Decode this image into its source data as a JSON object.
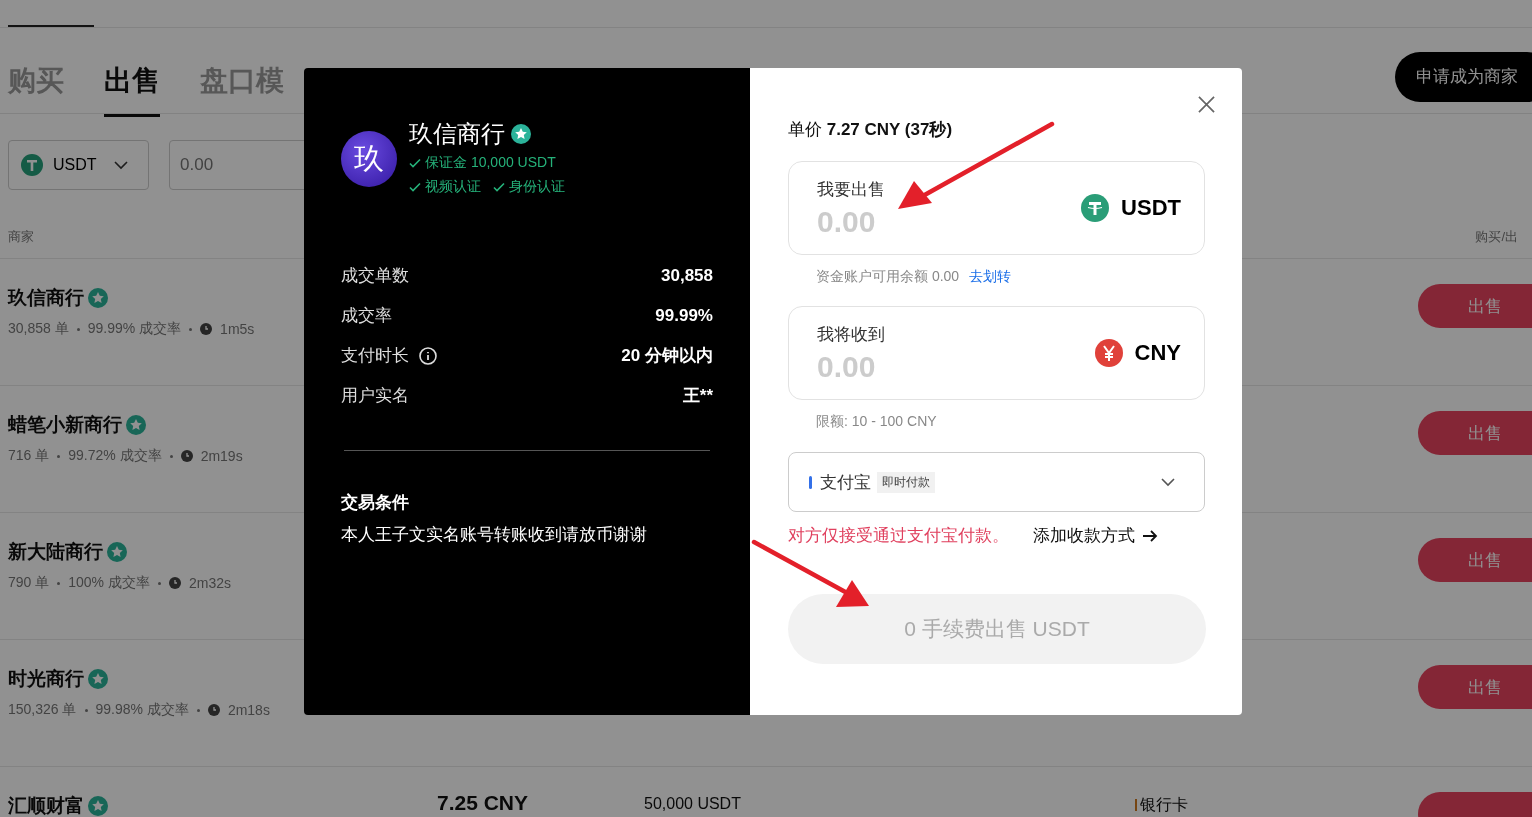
{
  "tabs": [
    {
      "label": "购买",
      "selected": false
    },
    {
      "label": "出售",
      "selected": true
    },
    {
      "label": "盘口模",
      "selected": false
    }
  ],
  "apply_button": "申请成为商家",
  "filters": {
    "coin": "USDT",
    "amount_placeholder": "0.00"
  },
  "table": {
    "columns": [
      {
        "label": "商家"
      },
      {
        "label": "购买/出"
      }
    ],
    "rows": [
      {
        "merchant": "玖信商行",
        "verified": true,
        "orders": "30,858 单",
        "rate": "99.99% 成交率",
        "time": "1m5s",
        "action": "出售"
      },
      {
        "merchant": "蜡笔小新商行",
        "verified": true,
        "orders": "716 单",
        "rate": "99.72% 成交率",
        "time": "2m19s",
        "action": "出售"
      },
      {
        "merchant": "新大陆商行",
        "verified": true,
        "orders": "790 单",
        "rate": "100% 成交率",
        "time": "2m32s",
        "action": "出售"
      },
      {
        "merchant": "时光商行",
        "verified": true,
        "orders": "150,326 单",
        "rate": "99.98% 成交率",
        "time": "2m18s",
        "action": "出售"
      },
      {
        "merchant": "汇顺财富",
        "verified": true,
        "price": "7.25 CNY",
        "limit": "50,000 USDT",
        "payment": "银行卡"
      }
    ]
  },
  "dialog": {
    "merchant": {
      "avatar": "玖",
      "name": "玖信商行",
      "verified": true,
      "badges": [
        "保证金 10,000 USDT",
        "视频认证",
        "身份认证"
      ]
    },
    "stats": [
      {
        "label": "成交单数",
        "value": "30,858",
        "info": false
      },
      {
        "label": "成交率",
        "value": "99.99%",
        "info": false
      },
      {
        "label": "支付时长",
        "value": "20 分钟以内",
        "info": true
      },
      {
        "label": "用户实名",
        "value": "王**",
        "info": false
      }
    ],
    "terms": {
      "title": "交易条件",
      "text": "本人王子文实名账号转账收到请放币谢谢"
    },
    "price": "单价 **7.27 CNY (37秒)**",
    "fields": [
      {
        "label": "我要出售",
        "placeholder": "0.00",
        "currency": "USDT",
        "kind": "usdt"
      },
      {
        "label": "我将收到",
        "placeholder": "0.00",
        "currency": "CNY",
        "kind": "cny"
      }
    ],
    "balance": "资金账户可用余额 0.00",
    "transfer_link": "去划转",
    "limit": "限额: 10 - 100 CNY",
    "payment": {
      "method": "支付宝",
      "tag": "即时付款"
    },
    "warning": "对方仅接受通过支付宝付款。",
    "add_method": "添加收款方式",
    "submit": {
      "label": "0 手续费出售 USDT",
      "disabled": true
    }
  }
}
